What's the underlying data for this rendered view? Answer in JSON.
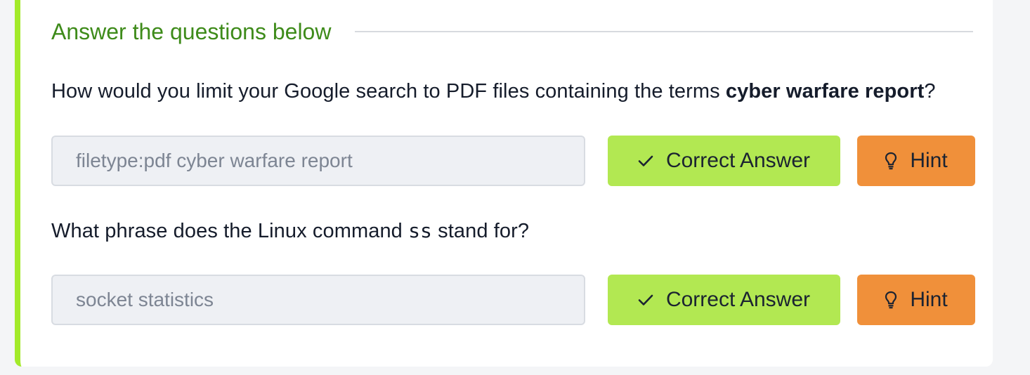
{
  "section": {
    "title": "Answer the questions below"
  },
  "questions": [
    {
      "text_before": "How would you limit your Google search to PDF files containing the terms ",
      "text_bold": "cyber warfare report",
      "text_after": "?",
      "answer": "filetype:pdf cyber warfare report",
      "correct_label": "Correct Answer",
      "hint_label": "Hint"
    },
    {
      "text_before": "What phrase does the Linux command ",
      "text_code": "ss",
      "text_after": " stand for?",
      "answer": "socket statistics",
      "correct_label": "Correct Answer",
      "hint_label": "Hint"
    }
  ],
  "colors": {
    "accent_green": "#a3ea2a",
    "title_green": "#3e8b1a",
    "correct_button": "#b2e852",
    "hint_button": "#f0903a"
  },
  "icons": {
    "correct": "check-icon",
    "hint": "lightbulb-icon"
  }
}
